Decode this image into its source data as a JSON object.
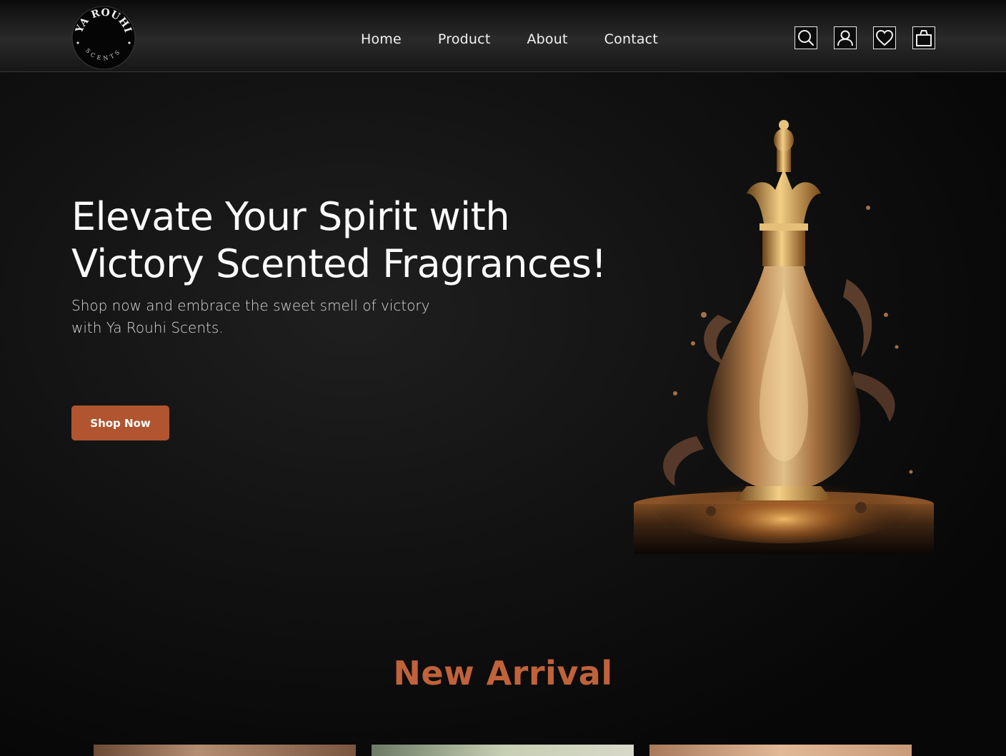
{
  "brand": {
    "name_top": "YA ROUHI",
    "name_bottom": "SCENTS"
  },
  "nav": {
    "items": [
      {
        "label": "Home"
      },
      {
        "label": "Product"
      },
      {
        "label": "About"
      },
      {
        "label": "Contact"
      }
    ]
  },
  "header_icons": [
    "search-icon",
    "user-icon",
    "heart-icon",
    "shopping-bag-icon"
  ],
  "hero": {
    "title_line1": "Elevate Your Spirit with",
    "title_line2": "Victory Scented Fragrances!",
    "subtitle_line1": "Shop now and embrace the sweet smell of victory",
    "subtitle_line2": "with Ya Rouhi Scents.",
    "cta_label": "Shop Now"
  },
  "new_arrival": {
    "title": "New Arrival"
  },
  "colors": {
    "accent": "#b0552f",
    "section_title": "#c0623a",
    "background": "#070707"
  }
}
